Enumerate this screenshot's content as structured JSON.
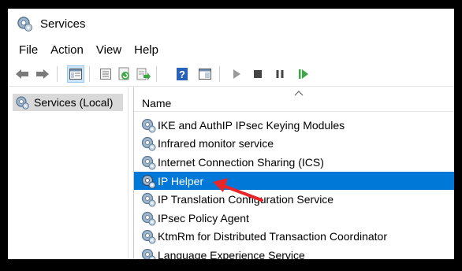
{
  "window": {
    "title": "Services"
  },
  "menu": [
    "File",
    "Action",
    "View",
    "Help"
  ],
  "toolbar": {
    "buttons": [
      "back-icon",
      "forward-icon",
      "show-console-tree-icon",
      "properties-icon",
      "refresh-icon",
      "export-list-icon",
      "help-icon",
      "console-icon",
      "start-service-icon",
      "stop-service-icon",
      "pause-service-icon",
      "restart-service-icon"
    ]
  },
  "tree": {
    "selected": "Services (Local)"
  },
  "list": {
    "column_header": "Name",
    "sort": "ascending",
    "rows": [
      "IKE and AuthIP IPsec Keying Modules",
      "Infrared monitor service",
      "Internet Connection Sharing (ICS)",
      "IP Helper",
      "IP Translation Configuration Service",
      "IPsec Policy Agent",
      "KtmRm for Distributed Transaction Coordinator",
      "Language Experience Service"
    ],
    "selected_row": "IP Helper"
  },
  "colors": {
    "selection": "#0078d7",
    "annotation_arrow": "#e8262a",
    "tree_selection": "#d9d9d9"
  }
}
